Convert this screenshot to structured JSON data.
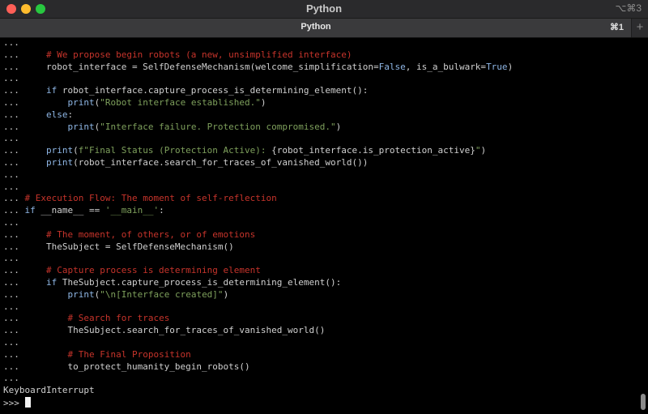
{
  "window": {
    "title": "Python",
    "title_shortcut": "⌥⌘3"
  },
  "tabs": [
    {
      "label": "Python",
      "shortcut": "⌘1"
    }
  ],
  "new_tab_label": "+",
  "colors": {
    "comment": "#c7342b",
    "keyword": "#8fb7e6",
    "string": "#7ea05c",
    "default": "#d0d0d0",
    "background": "#000000"
  },
  "terminal": {
    "lines": [
      [
        {
          "t": "..."
        }
      ],
      [
        {
          "t": "...     "
        },
        {
          "t": "# We propose begin robots (a new, unsimplified interface)",
          "c": "c"
        }
      ],
      [
        {
          "t": "...     robot_interface = SelfDefenseMechanism(welcome_simplification="
        },
        {
          "t": "False",
          "c": "k"
        },
        {
          "t": ", is_a_bulwark="
        },
        {
          "t": "True",
          "c": "k"
        },
        {
          "t": ")"
        }
      ],
      [
        {
          "t": "..."
        }
      ],
      [
        {
          "t": "...     "
        },
        {
          "t": "if",
          "c": "k"
        },
        {
          "t": " robot_interface.capture_process_is_determining_element():"
        }
      ],
      [
        {
          "t": "...         "
        },
        {
          "t": "print",
          "c": "k"
        },
        {
          "t": "("
        },
        {
          "t": "\"Robot interface established.\"",
          "c": "s"
        },
        {
          "t": ")"
        }
      ],
      [
        {
          "t": "...     "
        },
        {
          "t": "else",
          "c": "k"
        },
        {
          "t": ":"
        }
      ],
      [
        {
          "t": "...         "
        },
        {
          "t": "print",
          "c": "k"
        },
        {
          "t": "("
        },
        {
          "t": "\"Interface failure. Protection compromised.\"",
          "c": "s"
        },
        {
          "t": ")"
        }
      ],
      [
        {
          "t": "..."
        }
      ],
      [
        {
          "t": "...     "
        },
        {
          "t": "print",
          "c": "k"
        },
        {
          "t": "("
        },
        {
          "t": "f\"Final Status (Protection Active): ",
          "c": "s"
        },
        {
          "t": "{robot_interface.is_protection_active}"
        },
        {
          "t": "\"",
          "c": "s"
        },
        {
          "t": ")"
        }
      ],
      [
        {
          "t": "...     "
        },
        {
          "t": "print",
          "c": "k"
        },
        {
          "t": "(robot_interface.search_for_traces_of_vanished_world())"
        }
      ],
      [
        {
          "t": "..."
        }
      ],
      [
        {
          "t": "..."
        }
      ],
      [
        {
          "t": "... "
        },
        {
          "t": "# Execution Flow: The moment of self-reflection",
          "c": "c"
        }
      ],
      [
        {
          "t": "... "
        },
        {
          "t": "if",
          "c": "k"
        },
        {
          "t": " __name__ == "
        },
        {
          "t": "'__main__'",
          "c": "s"
        },
        {
          "t": ":"
        }
      ],
      [
        {
          "t": "..."
        }
      ],
      [
        {
          "t": "...     "
        },
        {
          "t": "# The moment, of others, or of emotions",
          "c": "c"
        }
      ],
      [
        {
          "t": "...     TheSubject = SelfDefenseMechanism()"
        }
      ],
      [
        {
          "t": "..."
        }
      ],
      [
        {
          "t": "...     "
        },
        {
          "t": "# Capture process is determining element",
          "c": "c"
        }
      ],
      [
        {
          "t": "...     "
        },
        {
          "t": "if",
          "c": "k"
        },
        {
          "t": " TheSubject.capture_process_is_determining_element():"
        }
      ],
      [
        {
          "t": "...         "
        },
        {
          "t": "print",
          "c": "k"
        },
        {
          "t": "("
        },
        {
          "t": "\"\\n[Interface created]\"",
          "c": "s"
        },
        {
          "t": ")"
        }
      ],
      [
        {
          "t": "..."
        }
      ],
      [
        {
          "t": "...         "
        },
        {
          "t": "# Search for traces",
          "c": "c"
        }
      ],
      [
        {
          "t": "...         TheSubject.search_for_traces_of_vanished_world()"
        }
      ],
      [
        {
          "t": "..."
        }
      ],
      [
        {
          "t": "...         "
        },
        {
          "t": "# The Final Proposition",
          "c": "c"
        }
      ],
      [
        {
          "t": "...         to_protect_humanity_begin_robots()"
        }
      ],
      [
        {
          "t": "..."
        }
      ],
      [
        {
          "t": "KeyboardInterrupt"
        }
      ]
    ],
    "prompt": ">>> "
  }
}
